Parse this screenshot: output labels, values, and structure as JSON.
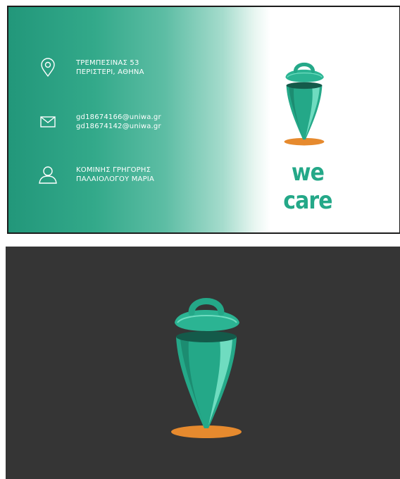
{
  "front": {
    "address": {
      "line1": "ΤΡΕΜΠΕΣΙΝΑΣ 53",
      "line2": "ΠΕΡΙΣΤΕΡΙ, ΑΘΗΝΑ",
      "icon": "location-pin-icon"
    },
    "email": {
      "line1": "gd18674166@uniwa.gr",
      "line2": "gd18674142@uniwa.gr",
      "icon": "envelope-icon"
    },
    "people": {
      "line1": "ΚΟΜΙΝΗΣ ΓΡΗΓΟΡΗΣ",
      "line2": "ΠΑΛΑΙΟΛΟΓΟΥ ΜΑΡΙΑ",
      "icon": "person-icon"
    },
    "brand": "we care"
  },
  "colors": {
    "primary_green": "#24a888",
    "light_green": "#6fdcc0",
    "dark_green": "#18735d",
    "accent_orange": "#e68a2e",
    "back_background": "#353535"
  }
}
